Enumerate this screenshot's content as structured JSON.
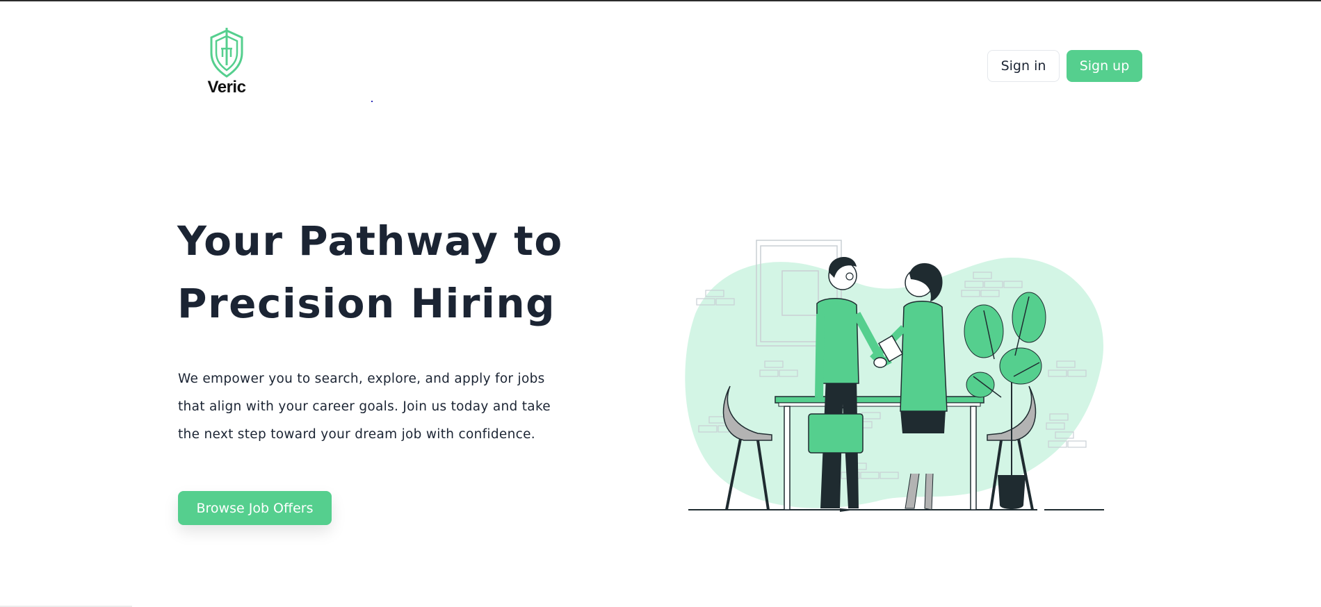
{
  "brand": {
    "name": "Veric",
    "color": "#55cf8e"
  },
  "header": {
    "signin_label": "Sign in",
    "signup_label": "Sign up"
  },
  "hero": {
    "title_line1": "Your Pathway to",
    "title_line2": "Precision Hiring",
    "description": "We empower you to search, explore, and apply for jobs that align with your career goals. Join us today and take the next step toward your dream job with confidence.",
    "cta_label": "Browse Job Offers"
  },
  "colors": {
    "accent": "#55cf8e",
    "text": "#1b2433",
    "blob": "#d3f5e5",
    "dark": "#1f2b30"
  },
  "illustration": {
    "subject": "handshake-meeting-illustration"
  }
}
